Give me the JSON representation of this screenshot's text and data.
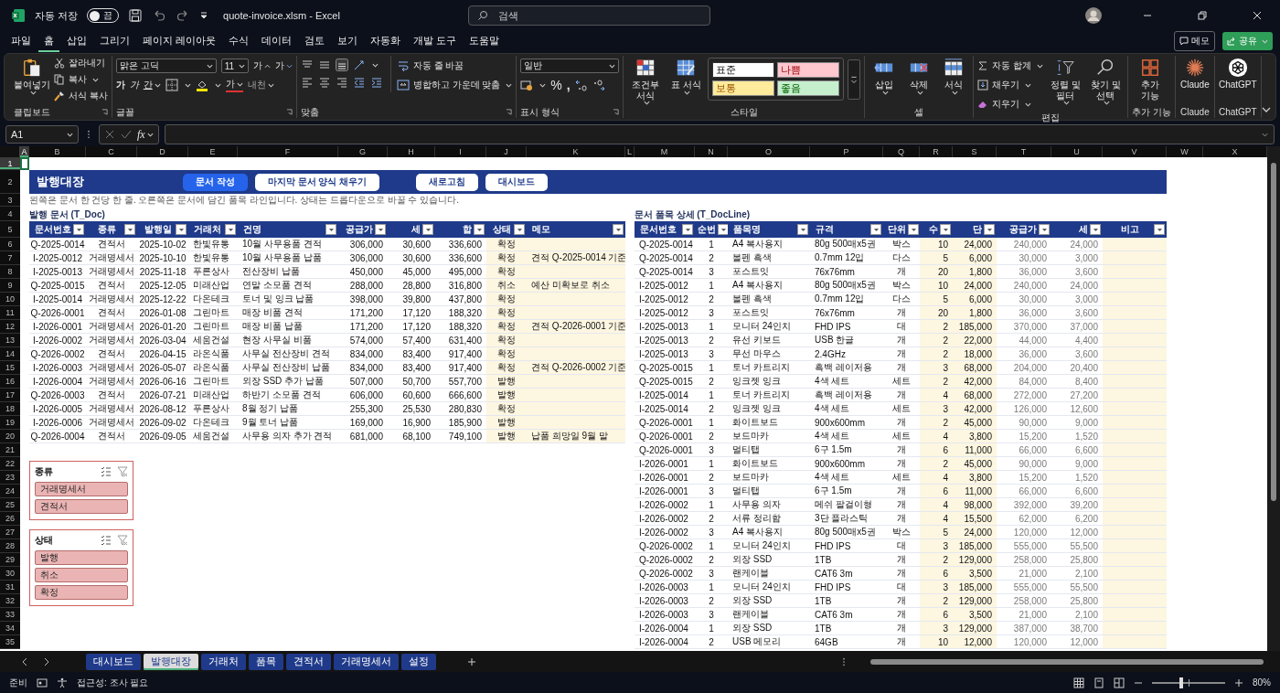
{
  "title_bar": {
    "autosave_label": "자동 저장",
    "autosave_toggle": {
      "label": "끔",
      "on": false
    },
    "file_title": "quote-invoice.xlsm  -  Excel",
    "search_placeholder": "검색"
  },
  "menu_tabs": [
    {
      "label": "파일",
      "selected": false
    },
    {
      "label": "홈",
      "selected": true
    },
    {
      "label": "삽입",
      "selected": false
    },
    {
      "label": "그리기",
      "selected": false
    },
    {
      "label": "페이지 레이아웃",
      "selected": false
    },
    {
      "label": "수식",
      "selected": false
    },
    {
      "label": "데이터",
      "selected": false
    },
    {
      "label": "검토",
      "selected": false
    },
    {
      "label": "보기",
      "selected": false
    },
    {
      "label": "자동화",
      "selected": false
    },
    {
      "label": "개발 도구",
      "selected": false
    },
    {
      "label": "도움말",
      "selected": false
    }
  ],
  "menu_buttons": {
    "memo": "메모",
    "share": "공유"
  },
  "ribbon": {
    "clipboard": {
      "paste": "붙여넣기",
      "cut": "잘라내기",
      "copy": "복사",
      "format_painter": "서식 복사",
      "label": "클립보드"
    },
    "font": {
      "font_name": "맑은 고딕",
      "font_size": "11",
      "grow": "가",
      "shrink": "가",
      "bold": "가",
      "italic": "가",
      "underline": "간",
      "font_color": "가",
      "phonetic": "내천",
      "label": "글꼴"
    },
    "alignment": {
      "wrap": "자동 줄 바꿈",
      "merge": "병합하고 가운데 맞춤",
      "label": "맞춤"
    },
    "number": {
      "format": "일반",
      "percent": "%",
      "comma": ",",
      "label": "표시 형식"
    },
    "styles": {
      "conditional": "조건부 서식",
      "table": "표 서식",
      "cell_styles": [
        {
          "label": "표준",
          "kind": "normal"
        },
        {
          "label": "나쁨",
          "kind": "bad"
        },
        {
          "label": "보통",
          "kind": "neutral"
        },
        {
          "label": "좋음",
          "kind": "good"
        }
      ],
      "label": "스타일"
    },
    "cells": {
      "insert": "삽입",
      "delete": "삭제",
      "format": "서식",
      "label": "셀"
    },
    "editing": {
      "autosum": "자동 합계",
      "fill": "채우기",
      "clear": "지우기",
      "sort": "정렬 및 필터",
      "find": "찾기 및 선택",
      "label": "편집"
    },
    "addins": {
      "button": "추가 기능",
      "label": "추가 기능"
    },
    "claude": {
      "button": "Claude",
      "label": "Claude"
    },
    "chatgpt": {
      "button": "ChatGPT",
      "label": "ChatGPT"
    }
  },
  "formula_bar": {
    "name_box": "A1",
    "fx": "fx"
  },
  "columns": [
    {
      "label": "A",
      "selected": true
    },
    {
      "label": "B",
      "selected": false
    },
    {
      "label": "C",
      "selected": false
    },
    {
      "label": "D",
      "selected": false
    },
    {
      "label": "E",
      "selected": false
    },
    {
      "label": "F",
      "selected": false
    },
    {
      "label": "G",
      "selected": false
    },
    {
      "label": "H",
      "selected": false
    },
    {
      "label": "I",
      "selected": false
    },
    {
      "label": "J",
      "selected": false
    },
    {
      "label": "K",
      "selected": false
    },
    {
      "label": "L",
      "selected": false
    },
    {
      "label": "M",
      "selected": false
    },
    {
      "label": "N",
      "selected": false
    },
    {
      "label": "O",
      "selected": false
    },
    {
      "label": "P",
      "selected": false
    },
    {
      "label": "Q",
      "selected": false
    },
    {
      "label": "R",
      "selected": false
    },
    {
      "label": "S",
      "selected": false
    },
    {
      "label": "T",
      "selected": false
    },
    {
      "label": "U",
      "selected": false
    },
    {
      "label": "V",
      "selected": false
    },
    {
      "label": "W",
      "selected": false
    },
    {
      "label": "X",
      "selected": false
    }
  ],
  "rows": [
    {
      "label": "1",
      "selected": true
    },
    {
      "label": "2",
      "selected": false
    },
    {
      "label": "3",
      "selected": false
    },
    {
      "label": "4",
      "selected": false
    },
    {
      "label": "5",
      "selected": false
    },
    {
      "label": "6",
      "selected": false
    },
    {
      "label": "7",
      "selected": false
    },
    {
      "label": "8",
      "selected": false
    },
    {
      "label": "9",
      "selected": false
    },
    {
      "label": "10",
      "selected": false
    },
    {
      "label": "11",
      "selected": false
    },
    {
      "label": "12",
      "selected": false
    },
    {
      "label": "13",
      "selected": false
    },
    {
      "label": "14",
      "selected": false
    },
    {
      "label": "15",
      "selected": false
    },
    {
      "label": "16",
      "selected": false
    },
    {
      "label": "17",
      "selected": false
    },
    {
      "label": "18",
      "selected": false
    },
    {
      "label": "19",
      "selected": false
    },
    {
      "label": "20",
      "selected": false
    },
    {
      "label": "21",
      "selected": false
    },
    {
      "label": "22",
      "selected": false
    },
    {
      "label": "23",
      "selected": false
    },
    {
      "label": "24",
      "selected": false
    },
    {
      "label": "25",
      "selected": false
    },
    {
      "label": "26",
      "selected": false
    },
    {
      "label": "27",
      "selected": false
    },
    {
      "label": "28",
      "selected": false
    },
    {
      "label": "29",
      "selected": false
    },
    {
      "label": "30",
      "selected": false
    },
    {
      "label": "31",
      "selected": false
    },
    {
      "label": "32",
      "selected": false
    },
    {
      "label": "33",
      "selected": false
    },
    {
      "label": "34",
      "selected": false
    },
    {
      "label": "35",
      "selected": false
    }
  ],
  "banner": {
    "title": "발행대장",
    "buttons": [
      {
        "label": "문서 작성",
        "primary": true
      },
      {
        "label": "마지막 문서 양식 채우기",
        "primary": false
      },
      {
        "label": "새로고침",
        "primary": false
      },
      {
        "label": "대시보드",
        "primary": false
      }
    ]
  },
  "note": "왼쪽은 문서 한 건당 한 줄. 오른쪽은 문서에 담긴 품목 라인입니다. 상태는 드롭다운으로 바꿀 수 있습니다.",
  "doc_table": {
    "title": "발행 문서 (T_Doc)",
    "columns": [
      {
        "label": "문서번호",
        "kind": "center"
      },
      {
        "label": "종류",
        "kind": "center"
      },
      {
        "label": "발행일",
        "kind": "center"
      },
      {
        "label": "거래처",
        "kind": "text"
      },
      {
        "label": "건명",
        "kind": "text"
      },
      {
        "label": "공급가",
        "kind": "number"
      },
      {
        "label": "세",
        "kind": "number"
      },
      {
        "label": "합",
        "kind": "number"
      },
      {
        "label": "상태",
        "kind": "center",
        "input": true
      },
      {
        "label": "메모",
        "kind": "text",
        "input": true
      }
    ],
    "rows": [
      [
        "Q-2025-0014",
        "견적서",
        "2025-10-02",
        "한빛유통",
        "10월 사무용품 견적",
        "306,000",
        "30,600",
        "336,600",
        "확정"
      ],
      [
        "I-2025-0012",
        "거래명세서",
        "2025-10-10",
        "한빛유통",
        "10월 사무용품 납품",
        "306,000",
        "30,600",
        "336,600",
        "확정",
        "견적 Q-2025-0014 기준"
      ],
      [
        "I-2025-0013",
        "거래명세서",
        "2025-11-18",
        "푸른상사",
        "전산장비 납품",
        "450,000",
        "45,000",
        "495,000",
        "확정"
      ],
      [
        "Q-2025-0015",
        "견적서",
        "2025-12-05",
        "미래산업",
        "연말 소모품 견적",
        "288,000",
        "28,800",
        "316,800",
        "취소",
        "예산 미확보로 취소"
      ],
      [
        "I-2025-0014",
        "거래명세서",
        "2025-12-22",
        "다온테크",
        "토너 및 잉크 납품",
        "398,000",
        "39,800",
        "437,800",
        "확정"
      ],
      [
        "Q-2026-0001",
        "견적서",
        "2026-01-08",
        "그린마트",
        "매장 비품 견적",
        "171,200",
        "17,120",
        "188,320",
        "확정"
      ],
      [
        "I-2026-0001",
        "거래명세서",
        "2026-01-20",
        "그린마트",
        "매장 비품 납품",
        "171,200",
        "17,120",
        "188,320",
        "확정",
        "견적 Q-2026-0001 기준"
      ],
      [
        "I-2026-0002",
        "거래명세서",
        "2026-03-04",
        "세움건설",
        "현장 사무실 비품",
        "574,000",
        "57,400",
        "631,400",
        "확정"
      ],
      [
        "Q-2026-0002",
        "견적서",
        "2026-04-15",
        "라온식품",
        "사무실 전산장비 견적",
        "834,000",
        "83,400",
        "917,400",
        "확정"
      ],
      [
        "I-2026-0003",
        "거래명세서",
        "2026-05-07",
        "라온식품",
        "사무실 전산장비 납품",
        "834,000",
        "83,400",
        "917,400",
        "확정",
        "견적 Q-2026-0002 기준"
      ],
      [
        "I-2026-0004",
        "거래명세서",
        "2026-06-16",
        "그린마트",
        "외장 SSD 추가 납품",
        "507,000",
        "50,700",
        "557,700",
        "발행"
      ],
      [
        "Q-2026-0003",
        "견적서",
        "2026-07-21",
        "미래산업",
        "하반기 소모품 견적",
        "606,000",
        "60,600",
        "666,600",
        "발행"
      ],
      [
        "I-2026-0005",
        "거래명세서",
        "2026-08-12",
        "푸른상사",
        "8월 정기 납품",
        "255,300",
        "25,530",
        "280,830",
        "확정"
      ],
      [
        "I-2026-0006",
        "거래명세서",
        "2026-09-02",
        "다온테크",
        "9월 토너 납품",
        "169,000",
        "16,900",
        "185,900",
        "발행"
      ],
      [
        "Q-2026-0004",
        "견적서",
        "2026-09-05",
        "세움건설",
        "사무용 의자 추가 견적",
        "681,000",
        "68,100",
        "749,100",
        "발행",
        "납품 희망일 9월 말"
      ]
    ]
  },
  "line_table": {
    "title": "문서 품목 상세 (T_DocLine)",
    "columns": [
      {
        "label": "문서번호",
        "kind": "text"
      },
      {
        "label": "순번",
        "kind": "center"
      },
      {
        "label": "품목명",
        "kind": "text"
      },
      {
        "label": "규격",
        "kind": "text"
      },
      {
        "label": "단위",
        "kind": "center"
      },
      {
        "label": "수",
        "kind": "number",
        "input": true
      },
      {
        "label": "단",
        "kind": "number",
        "input": true
      },
      {
        "label": "공급가",
        "kind": "number",
        "calculated": true
      },
      {
        "label": "세",
        "kind": "number",
        "calculated": true
      },
      {
        "label": "비고",
        "kind": "center",
        "input": true
      }
    ],
    "rows": [
      [
        "Q-2025-0014",
        "1",
        "A4 복사용지",
        "80g 500매x5권",
        "박스",
        "10",
        "24,000",
        "240,000",
        "24,000"
      ],
      [
        "Q-2025-0014",
        "2",
        "볼펜 흑색",
        "0.7mm 12입",
        "다스",
        "5",
        "6,000",
        "30,000",
        "3,000"
      ],
      [
        "Q-2025-0014",
        "3",
        "포스트잇",
        "76x76mm",
        "개",
        "20",
        "1,800",
        "36,000",
        "3,600"
      ],
      [
        "I-2025-0012",
        "1",
        "A4 복사용지",
        "80g 500매x5권",
        "박스",
        "10",
        "24,000",
        "240,000",
        "24,000"
      ],
      [
        "I-2025-0012",
        "2",
        "볼펜 흑색",
        "0.7mm 12입",
        "다스",
        "5",
        "6,000",
        "30,000",
        "3,000"
      ],
      [
        "I-2025-0012",
        "3",
        "포스트잇",
        "76x76mm",
        "개",
        "20",
        "1,800",
        "36,000",
        "3,600"
      ],
      [
        "I-2025-0013",
        "1",
        "모니터 24인치",
        "FHD IPS",
        "대",
        "2",
        "185,000",
        "370,000",
        "37,000"
      ],
      [
        "I-2025-0013",
        "2",
        "유선 키보드",
        "USB 한글",
        "개",
        "2",
        "22,000",
        "44,000",
        "4,400"
      ],
      [
        "I-2025-0013",
        "3",
        "무선 마우스",
        "2.4GHz",
        "개",
        "2",
        "18,000",
        "36,000",
        "3,600"
      ],
      [
        "Q-2025-0015",
        "1",
        "토너 카트리지",
        "흑백 레이저용",
        "개",
        "3",
        "68,000",
        "204,000",
        "20,400"
      ],
      [
        "Q-2025-0015",
        "2",
        "잉크젯 잉크",
        "4색 세트",
        "세트",
        "2",
        "42,000",
        "84,000",
        "8,400"
      ],
      [
        "I-2025-0014",
        "1",
        "토너 카트리지",
        "흑백 레이저용",
        "개",
        "4",
        "68,000",
        "272,000",
        "27,200"
      ],
      [
        "I-2025-0014",
        "2",
        "잉크젯 잉크",
        "4색 세트",
        "세트",
        "3",
        "42,000",
        "126,000",
        "12,600"
      ],
      [
        "Q-2026-0001",
        "1",
        "화이트보드",
        "900x600mm",
        "개",
        "2",
        "45,000",
        "90,000",
        "9,000"
      ],
      [
        "Q-2026-0001",
        "2",
        "보드마카",
        "4색 세트",
        "세트",
        "4",
        "3,800",
        "15,200",
        "1,520"
      ],
      [
        "Q-2026-0001",
        "3",
        "멀티탭",
        "6구 1.5m",
        "개",
        "6",
        "11,000",
        "66,000",
        "6,600"
      ],
      [
        "I-2026-0001",
        "1",
        "화이트보드",
        "900x600mm",
        "개",
        "2",
        "45,000",
        "90,000",
        "9,000"
      ],
      [
        "I-2026-0001",
        "2",
        "보드마카",
        "4색 세트",
        "세트",
        "4",
        "3,800",
        "15,200",
        "1,520"
      ],
      [
        "I-2026-0001",
        "3",
        "멀티탭",
        "6구 1.5m",
        "개",
        "6",
        "11,000",
        "66,000",
        "6,600"
      ],
      [
        "I-2026-0002",
        "1",
        "사무용 의자",
        "메쉬 팔걸이형",
        "개",
        "4",
        "98,000",
        "392,000",
        "39,200"
      ],
      [
        "I-2026-0002",
        "2",
        "서류 정리함",
        "3단 플라스틱",
        "개",
        "4",
        "15,500",
        "62,000",
        "6,200"
      ],
      [
        "I-2026-0002",
        "3",
        "A4 복사용지",
        "80g 500매x5권",
        "박스",
        "5",
        "24,000",
        "120,000",
        "12,000"
      ],
      [
        "Q-2026-0002",
        "1",
        "모니터 24인치",
        "FHD IPS",
        "대",
        "3",
        "185,000",
        "555,000",
        "55,500"
      ],
      [
        "Q-2026-0002",
        "2",
        "외장 SSD",
        "1TB",
        "개",
        "2",
        "129,000",
        "258,000",
        "25,800"
      ],
      [
        "Q-2026-0002",
        "3",
        "랜케이블",
        "CAT6 3m",
        "개",
        "6",
        "3,500",
        "21,000",
        "2,100"
      ],
      [
        "I-2026-0003",
        "1",
        "모니터 24인치",
        "FHD IPS",
        "대",
        "3",
        "185,000",
        "555,000",
        "55,500"
      ],
      [
        "I-2026-0003",
        "2",
        "외장 SSD",
        "1TB",
        "개",
        "2",
        "129,000",
        "258,000",
        "25,800"
      ],
      [
        "I-2026-0003",
        "3",
        "랜케이블",
        "CAT6 3m",
        "개",
        "6",
        "3,500",
        "21,000",
        "2,100"
      ],
      [
        "I-2026-0004",
        "1",
        "외장 SSD",
        "1TB",
        "개",
        "3",
        "129,000",
        "387,000",
        "38,700"
      ],
      [
        "I-2026-0004",
        "2",
        "USB 메모리",
        "64GB",
        "개",
        "10",
        "12,000",
        "120,000",
        "12,000"
      ]
    ]
  },
  "slicers": [
    {
      "title": "종류",
      "items": [
        {
          "label": "거래명세서",
          "selected": true
        },
        {
          "label": "견적서",
          "selected": true
        }
      ]
    },
    {
      "title": "상태",
      "items": [
        {
          "label": "발행",
          "selected": true
        },
        {
          "label": "취소",
          "selected": true
        },
        {
          "label": "확정",
          "selected": true
        }
      ]
    }
  ],
  "sheet_tabs": [
    {
      "label": "대시보드",
      "selected": false
    },
    {
      "label": "발행대장",
      "selected": true
    },
    {
      "label": "거래처",
      "selected": false
    },
    {
      "label": "품목",
      "selected": false
    },
    {
      "label": "견적서",
      "selected": false
    },
    {
      "label": "거래명세서",
      "selected": false
    },
    {
      "label": "설정",
      "selected": false
    }
  ],
  "status_bar": {
    "ready": "준비",
    "accessibility": "접근성: 조사 필요",
    "zoom": "80%",
    "zoom_slider": {
      "level": 0.4
    }
  }
}
